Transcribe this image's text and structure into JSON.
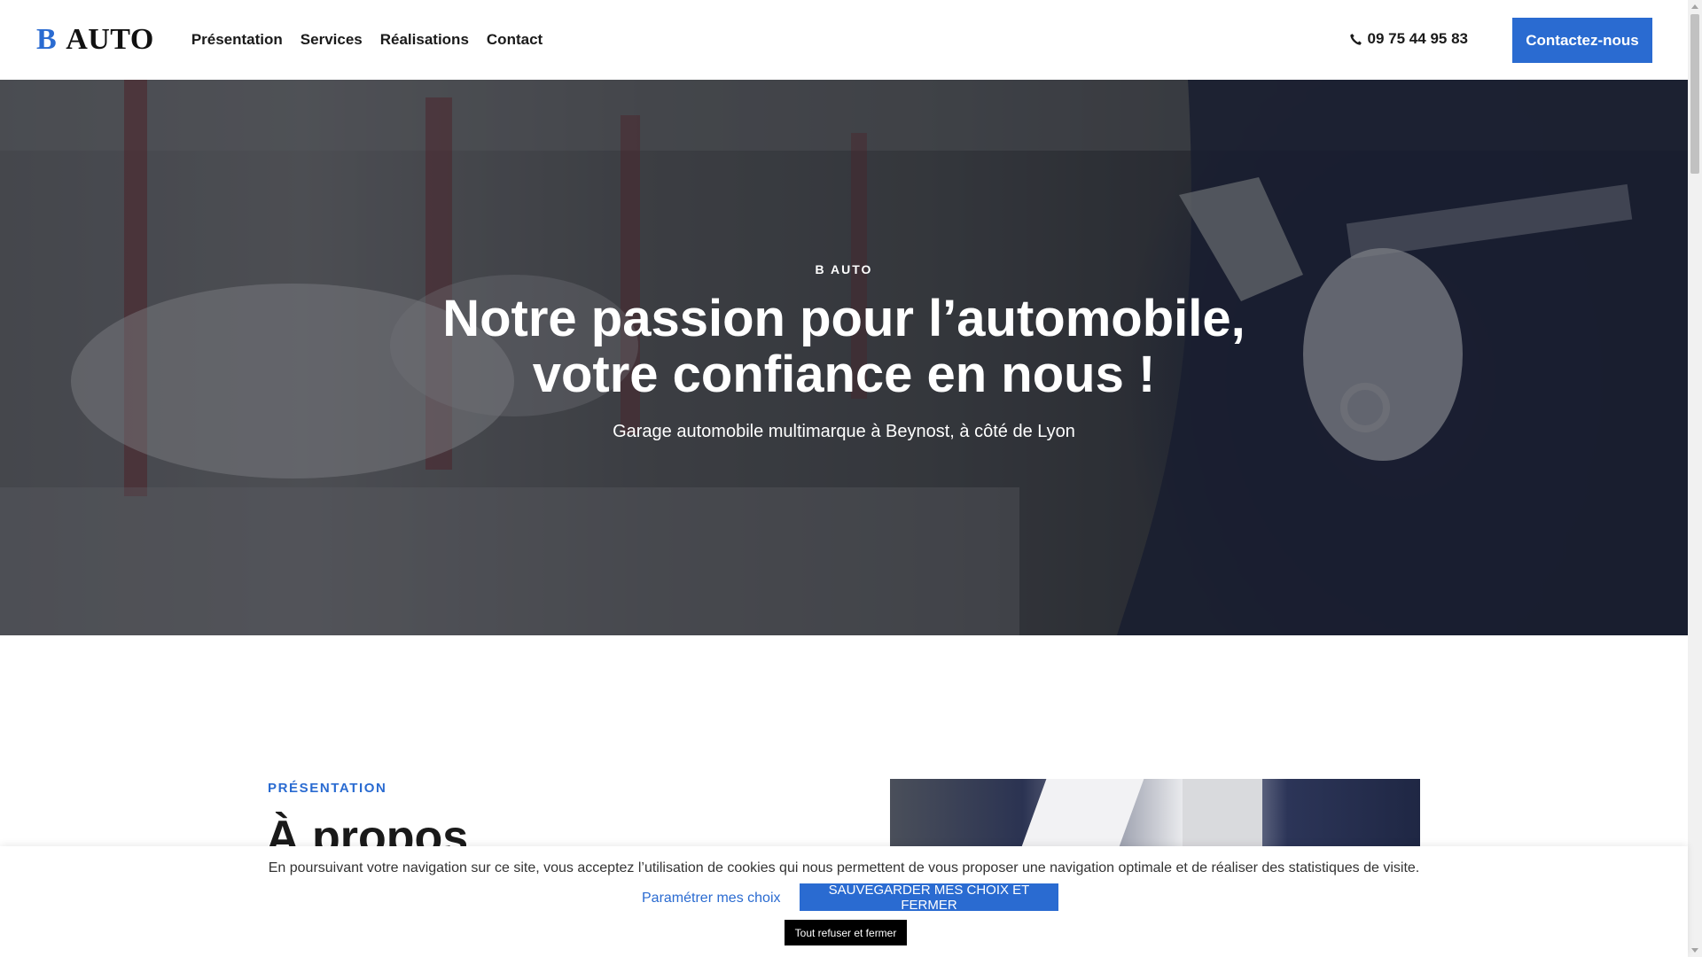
{
  "header": {
    "logo_b": "B",
    "logo_auto": "AUTO",
    "nav": [
      "Présentation",
      "Services",
      "Réalisations",
      "Contact"
    ],
    "phone": "09 75 44 95 83",
    "cta": "Contactez-nous"
  },
  "hero": {
    "eyebrow": "B AUTO",
    "title_line1": "Notre passion pour l’automobile,",
    "title_line2": "votre confiance en nous !",
    "subtitle": "Garage automobile multimarque à Beynost, à côté de Lyon"
  },
  "about": {
    "eyebrow": "PRÉSENTATION",
    "title": "À propos"
  },
  "cookie": {
    "text": "En poursuivant votre navigation sur ce site, vous acceptez l’utilisation de cookies qui nous permettent de vous proposer une navigation optimale et de réaliser des statistiques de visite.",
    "settings": "Paramétrer mes choix",
    "save": "SAUVEGARDER MES CHOIX ET FERMER",
    "refuse": "Tout refuser et fermer"
  },
  "colors": {
    "accent": "#2a6bd1",
    "text": "#1a1a1a"
  },
  "icons": {
    "phone": "phone-icon"
  }
}
